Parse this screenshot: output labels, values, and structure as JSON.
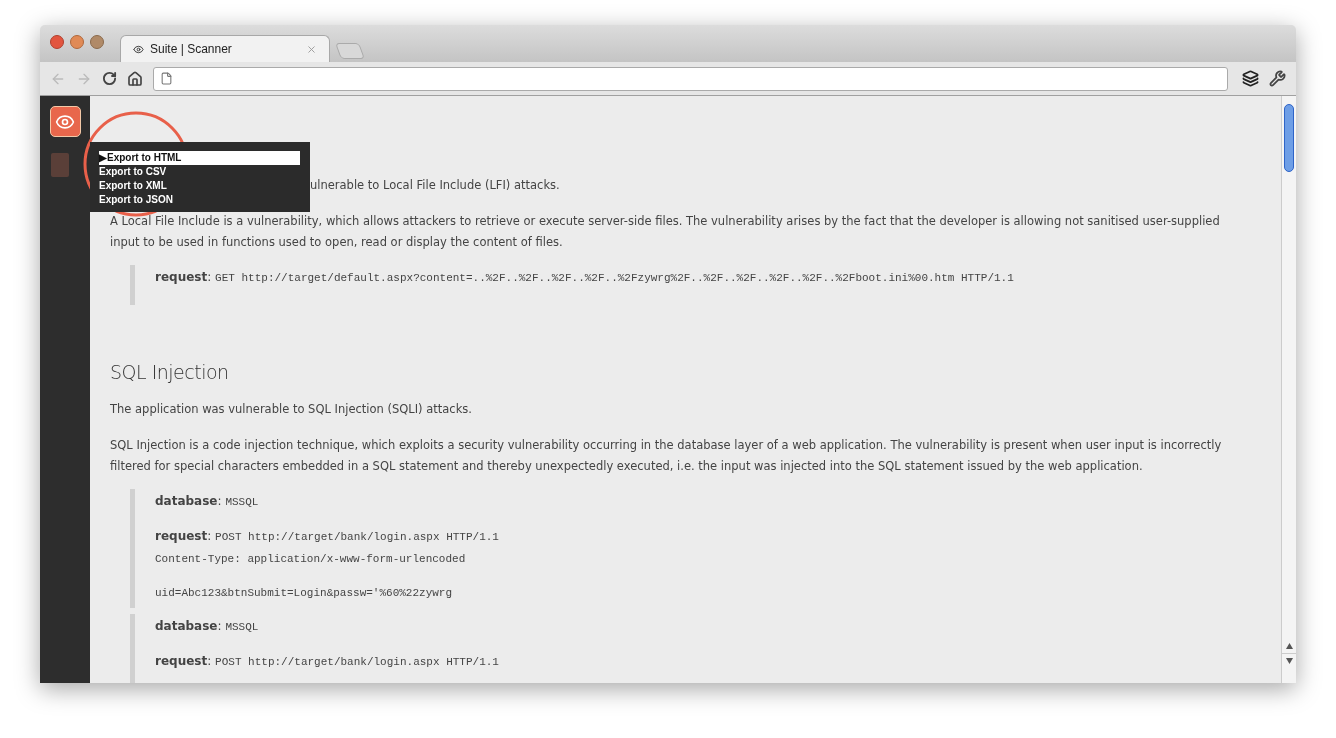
{
  "window": {
    "tab": {
      "title": "Suite | Scanner",
      "selected": true
    }
  },
  "sidebar": {
    "items": [
      {
        "kind": "eye",
        "selected": true
      },
      {
        "kind": "report",
        "selected": false
      }
    ]
  },
  "menu": {
    "pointer": "▶",
    "items": [
      {
        "label": "Export to HTML",
        "selected": true
      },
      {
        "label": "Export to CSV",
        "selected": false
      },
      {
        "label": "Export to XML",
        "selected": false
      },
      {
        "label": "Export to JSON",
        "selected": false
      }
    ]
  },
  "sections": [
    {
      "summary": "ulnerable to Local File Include (LFI) attacks.",
      "description": "A Local File Include is a vulnerability, which allows attackers to retrieve or execute server-side files. The vulnerability arises by the fact that the developer is allowing not sanitised user-supplied input to be used in functions used to open, read or display the content of files.",
      "blocks": [
        [
          {
            "kind": "field",
            "label": "request",
            "sep": ":",
            "value": "GET http://target/default.aspx?content=..%2F..%2F..%2F..%2F..%2Fzywrg%2F..%2F..%2F..%2F..%2F..%2Fboot.ini%00.htm HTTP/1.1"
          }
        ]
      ]
    },
    {
      "title": "SQL Injection",
      "summary": "The application was vulnerable to SQL Injection (SQLI) attacks.",
      "description": "SQL Injection is a code injection technique, which exploits a security vulnerability occurring in the database layer of a web application. The vulnerability is present when user input is incorrectly filtered for special characters embedded in a SQL statement and thereby unexpectedly executed, i.e. the input was injected into the SQL statement issued by the web application.",
      "blocks": [
        [
          {
            "kind": "field",
            "label": "database",
            "sep": ":",
            "value": "MSSQL"
          },
          {
            "kind": "field",
            "label": "request",
            "sep": ":",
            "value": "POST http://target/bank/login.aspx HTTP/1.1"
          },
          {
            "kind": "line",
            "value": "Content-Type: application/x-www-form-urlencoded"
          },
          {
            "kind": "body",
            "value": "uid=Abc123&btnSubmit=Login&passw='%60%22zywrg"
          }
        ],
        [
          {
            "kind": "field",
            "label": "database",
            "sep": ":",
            "value": "MSSQL"
          },
          {
            "kind": "field",
            "label": "request",
            "sep": ":",
            "value": "POST http://target/bank/login.aspx HTTP/1.1"
          }
        ]
      ]
    }
  ]
}
